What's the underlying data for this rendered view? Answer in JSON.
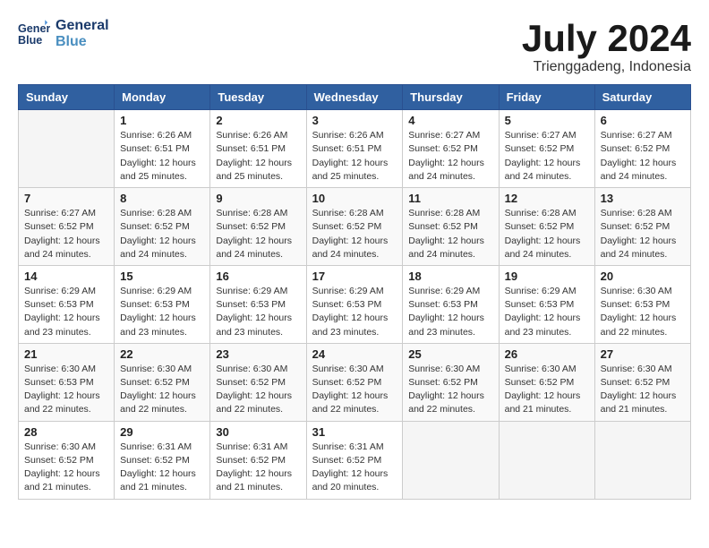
{
  "logo": {
    "line1": "General",
    "line2": "Blue"
  },
  "title": "July 2024",
  "location": "Trienggadeng, Indonesia",
  "headers": [
    "Sunday",
    "Monday",
    "Tuesday",
    "Wednesday",
    "Thursday",
    "Friday",
    "Saturday"
  ],
  "weeks": [
    [
      {
        "day": "",
        "info": ""
      },
      {
        "day": "1",
        "info": "Sunrise: 6:26 AM\nSunset: 6:51 PM\nDaylight: 12 hours\nand 25 minutes."
      },
      {
        "day": "2",
        "info": "Sunrise: 6:26 AM\nSunset: 6:51 PM\nDaylight: 12 hours\nand 25 minutes."
      },
      {
        "day": "3",
        "info": "Sunrise: 6:26 AM\nSunset: 6:51 PM\nDaylight: 12 hours\nand 25 minutes."
      },
      {
        "day": "4",
        "info": "Sunrise: 6:27 AM\nSunset: 6:52 PM\nDaylight: 12 hours\nand 24 minutes."
      },
      {
        "day": "5",
        "info": "Sunrise: 6:27 AM\nSunset: 6:52 PM\nDaylight: 12 hours\nand 24 minutes."
      },
      {
        "day": "6",
        "info": "Sunrise: 6:27 AM\nSunset: 6:52 PM\nDaylight: 12 hours\nand 24 minutes."
      }
    ],
    [
      {
        "day": "7",
        "info": "Sunrise: 6:27 AM\nSunset: 6:52 PM\nDaylight: 12 hours\nand 24 minutes."
      },
      {
        "day": "8",
        "info": "Sunrise: 6:28 AM\nSunset: 6:52 PM\nDaylight: 12 hours\nand 24 minutes."
      },
      {
        "day": "9",
        "info": "Sunrise: 6:28 AM\nSunset: 6:52 PM\nDaylight: 12 hours\nand 24 minutes."
      },
      {
        "day": "10",
        "info": "Sunrise: 6:28 AM\nSunset: 6:52 PM\nDaylight: 12 hours\nand 24 minutes."
      },
      {
        "day": "11",
        "info": "Sunrise: 6:28 AM\nSunset: 6:52 PM\nDaylight: 12 hours\nand 24 minutes."
      },
      {
        "day": "12",
        "info": "Sunrise: 6:28 AM\nSunset: 6:52 PM\nDaylight: 12 hours\nand 24 minutes."
      },
      {
        "day": "13",
        "info": "Sunrise: 6:28 AM\nSunset: 6:52 PM\nDaylight: 12 hours\nand 24 minutes."
      }
    ],
    [
      {
        "day": "14",
        "info": "Sunrise: 6:29 AM\nSunset: 6:53 PM\nDaylight: 12 hours\nand 23 minutes."
      },
      {
        "day": "15",
        "info": "Sunrise: 6:29 AM\nSunset: 6:53 PM\nDaylight: 12 hours\nand 23 minutes."
      },
      {
        "day": "16",
        "info": "Sunrise: 6:29 AM\nSunset: 6:53 PM\nDaylight: 12 hours\nand 23 minutes."
      },
      {
        "day": "17",
        "info": "Sunrise: 6:29 AM\nSunset: 6:53 PM\nDaylight: 12 hours\nand 23 minutes."
      },
      {
        "day": "18",
        "info": "Sunrise: 6:29 AM\nSunset: 6:53 PM\nDaylight: 12 hours\nand 23 minutes."
      },
      {
        "day": "19",
        "info": "Sunrise: 6:29 AM\nSunset: 6:53 PM\nDaylight: 12 hours\nand 23 minutes."
      },
      {
        "day": "20",
        "info": "Sunrise: 6:30 AM\nSunset: 6:53 PM\nDaylight: 12 hours\nand 22 minutes."
      }
    ],
    [
      {
        "day": "21",
        "info": "Sunrise: 6:30 AM\nSunset: 6:53 PM\nDaylight: 12 hours\nand 22 minutes."
      },
      {
        "day": "22",
        "info": "Sunrise: 6:30 AM\nSunset: 6:52 PM\nDaylight: 12 hours\nand 22 minutes."
      },
      {
        "day": "23",
        "info": "Sunrise: 6:30 AM\nSunset: 6:52 PM\nDaylight: 12 hours\nand 22 minutes."
      },
      {
        "day": "24",
        "info": "Sunrise: 6:30 AM\nSunset: 6:52 PM\nDaylight: 12 hours\nand 22 minutes."
      },
      {
        "day": "25",
        "info": "Sunrise: 6:30 AM\nSunset: 6:52 PM\nDaylight: 12 hours\nand 22 minutes."
      },
      {
        "day": "26",
        "info": "Sunrise: 6:30 AM\nSunset: 6:52 PM\nDaylight: 12 hours\nand 21 minutes."
      },
      {
        "day": "27",
        "info": "Sunrise: 6:30 AM\nSunset: 6:52 PM\nDaylight: 12 hours\nand 21 minutes."
      }
    ],
    [
      {
        "day": "28",
        "info": "Sunrise: 6:30 AM\nSunset: 6:52 PM\nDaylight: 12 hours\nand 21 minutes."
      },
      {
        "day": "29",
        "info": "Sunrise: 6:31 AM\nSunset: 6:52 PM\nDaylight: 12 hours\nand 21 minutes."
      },
      {
        "day": "30",
        "info": "Sunrise: 6:31 AM\nSunset: 6:52 PM\nDaylight: 12 hours\nand 21 minutes."
      },
      {
        "day": "31",
        "info": "Sunrise: 6:31 AM\nSunset: 6:52 PM\nDaylight: 12 hours\nand 20 minutes."
      },
      {
        "day": "",
        "info": ""
      },
      {
        "day": "",
        "info": ""
      },
      {
        "day": "",
        "info": ""
      }
    ]
  ]
}
